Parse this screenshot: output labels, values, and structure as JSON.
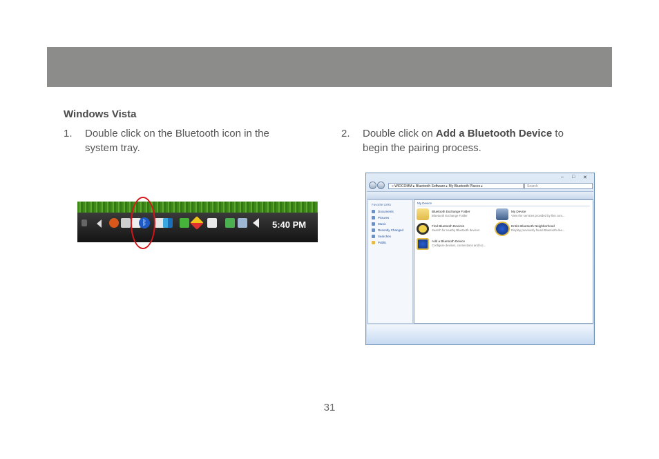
{
  "section_heading": "Windows Vista",
  "steps": [
    {
      "number": "1.",
      "line1": "Double click on the Bluetooth icon in the",
      "line2": "system tray."
    },
    {
      "number": "2.",
      "prefix": "Double click on ",
      "bold": "Add a Bluetooth Device",
      "suffix": " to",
      "line2": "begin the pairing process."
    }
  ],
  "taskbar": {
    "time": "5:40 PM"
  },
  "explorer": {
    "address": "« WIDCOMM ▸ Bluetooth Software ▸ My Bluetooth Places ▸",
    "search_placeholder": "Search",
    "favorites_title": "Favorite Links",
    "favorites": [
      "Documents",
      "Pictures",
      "Music",
      "Recently Changed",
      "Searches",
      "Public"
    ],
    "group_title": "My Device",
    "items": [
      {
        "name": "Bluetooth Exchange Folder",
        "desc": "Bluetooth Exchange Folder",
        "icon": "folder-icon"
      },
      {
        "name": "My Device",
        "desc": "View the services provided by this com...",
        "icon": "laptop-icon"
      },
      {
        "name": "Find Bluetooth Devices",
        "desc": "Search for nearby Bluetooth devices",
        "icon": "magnifier-icon"
      },
      {
        "name": "Entire Bluetooth Neighborhood",
        "desc": "Display previously found Bluetooth dev...",
        "icon": "bluetooth-icon"
      },
      {
        "name": "Add a Bluetooth Device",
        "desc": "Configure devices, connections and loc...",
        "icon": "bluetooth-add-icon"
      }
    ],
    "window_controls": {
      "minimize": "–",
      "maximize": "□",
      "close": "✕"
    }
  },
  "page_number": "31",
  "colors": {
    "banner": "#8c8c8b",
    "highlight_ring": "#d7141a"
  }
}
